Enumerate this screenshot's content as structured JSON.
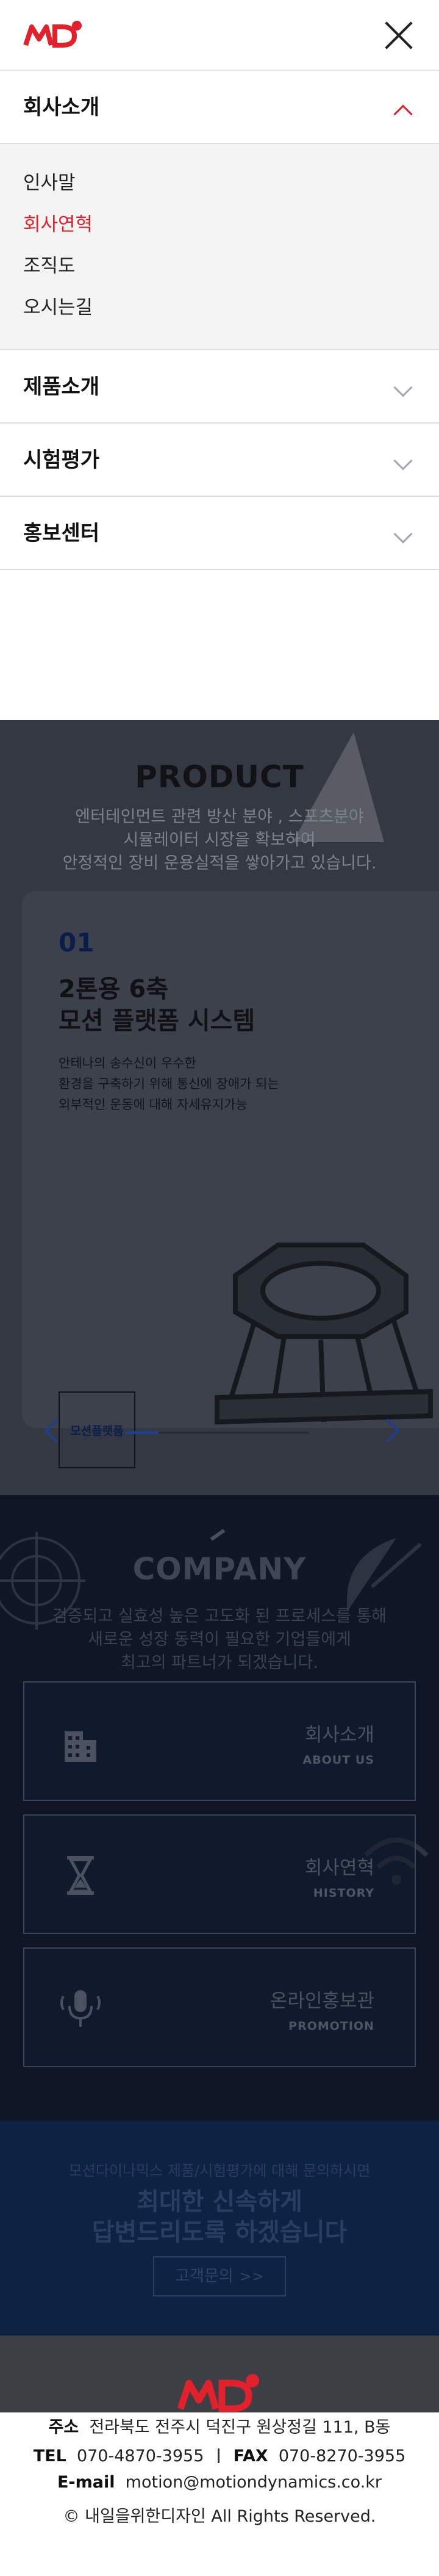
{
  "header": {
    "logo_alt": "MD",
    "close_icon": "close-icon"
  },
  "menu": {
    "items": [
      {
        "label": "회사소개",
        "expanded": true
      },
      {
        "label": "제품소개",
        "expanded": false
      },
      {
        "label": "시험평가",
        "expanded": false
      },
      {
        "label": "홍보센터",
        "expanded": false
      }
    ],
    "submenu": [
      "인사말",
      "회사연혁",
      "조직도",
      "오시는길"
    ],
    "active_submenu": "회사연혁"
  },
  "product": {
    "title": "PRODUCT",
    "desc": [
      "엔터테인먼트 관련 방산 분야 , 스포츠분야",
      "시뮬레이터 시장을 확보하여",
      "안정적인 장비 운용실적을 쌓아가고 있습니다."
    ],
    "card": {
      "num": "01",
      "title": [
        "2톤용 6축",
        "모션 플랫폼 시스템"
      ],
      "text": [
        "안테나의 송수신이 우수한",
        "환경을 구축하기 위해 통신에 장애가 되는",
        "외부적인 운동에 대해 자세유지가능"
      ],
      "tag": [
        "모션플랫폼"
      ]
    },
    "slider_progress": 0.18
  },
  "company": {
    "title": "COMPANY",
    "desc": [
      "검증되고 실효성 높은 고도화 된 프로세스를 통해",
      "새로운 성장 동력이 필요한 기업들에게",
      "최고의 파트너가 되겠습니다."
    ],
    "boxes": [
      {
        "kr": "회사소개",
        "en": "ABOUT US",
        "icon": "building-icon"
      },
      {
        "kr": "회사연혁",
        "en": "HISTORY",
        "icon": "hourglass-icon"
      },
      {
        "kr": "온라인홍보관",
        "en": "PROMOTION",
        "icon": "microphone-icon"
      }
    ]
  },
  "contact": {
    "small": "모션다이나믹스 제품/시험평가에 대해 문의하시면",
    "big": [
      "최대한 신속하게",
      "답변드리도록 하겠습니다"
    ],
    "button": "고객문의",
    "button_arrow": ">>"
  },
  "footer": {
    "address_label": "주소",
    "address": "전라북도 전주시 덕진구 원상정길 111, B동",
    "tel_label": "TEL",
    "tel": "070-4870-3955",
    "fax_label": "FAX",
    "fax": "070-8270-3955",
    "email_label": "E-mail",
    "email": "motion@motiondynamics.co.kr",
    "copyright": "© 내일을위한디자인  All Rights Reserved."
  },
  "colors": {
    "accent_red": "#e1212c",
    "navy": "#1d3f8c"
  }
}
